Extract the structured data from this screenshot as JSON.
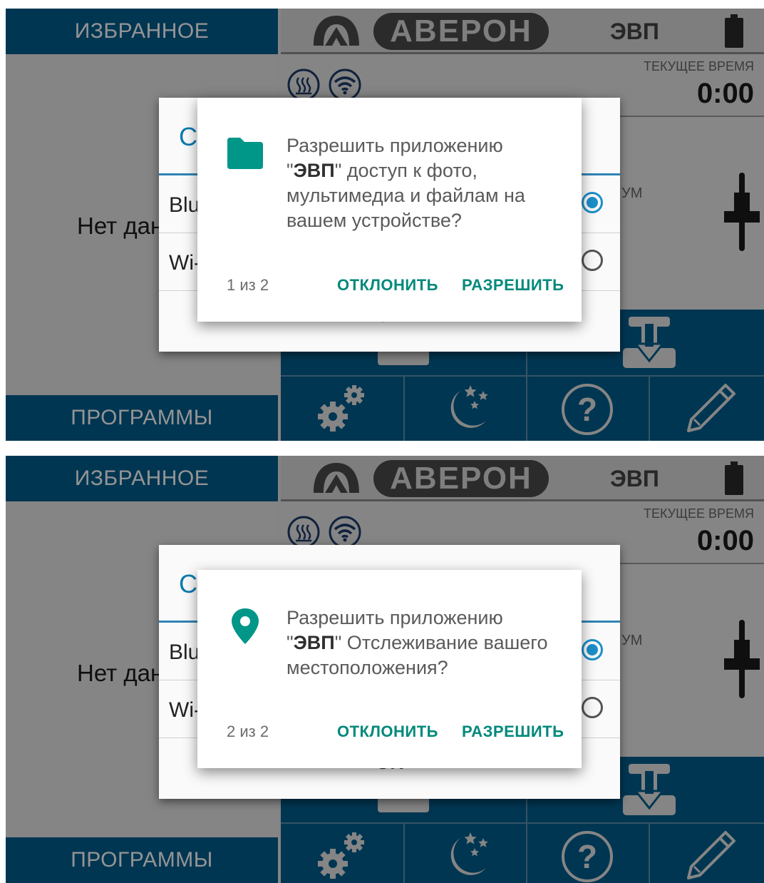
{
  "colors": {
    "brand_blue": "#005d8e",
    "dialog_accent": "#00897b",
    "connection_accent": "#1b8fc8"
  },
  "app": {
    "favorites_label": "ИЗБРАННОЕ",
    "programs_label": "ПРОГРАММЫ",
    "no_data_text": "Нет дан",
    "brand_text": "АВЕРОН",
    "app_name": "ЭВП",
    "current_time_label": "ТЕКУЩЕЕ ВРЕМЯ",
    "current_time": "0:00",
    "vu_label": "УМ",
    "icons": [
      "averon-logo-icon",
      "battery-icon",
      "heat-icon",
      "wifi-icon",
      "slider-icon",
      "upload-icon",
      "gears-icon",
      "night-icon",
      "help-icon",
      "edit-icon"
    ]
  },
  "connection_dialog": {
    "title": "Со",
    "options": [
      {
        "label": "Blue",
        "selected": true
      },
      {
        "label": "Wi-F",
        "selected": false
      }
    ],
    "ok_label": "OK"
  },
  "screens": [
    {
      "permission": {
        "icon": "folder-icon",
        "text_prefix": "Разрешить приложению\n\"",
        "app_name": "ЭВП",
        "text_suffix": "\" доступ к фото, мультимедиа и файлам на вашем устройстве?",
        "counter": "1 из 2",
        "deny_label": "ОТКЛОНИТЬ",
        "allow_label": "РАЗРЕШИТЬ"
      }
    },
    {
      "permission": {
        "icon": "location-pin-icon",
        "text_prefix": "Разрешить приложению\n\"",
        "app_name": "ЭВП",
        "text_suffix": "\" Отслеживание вашего местоположения?",
        "counter": "2 из 2",
        "deny_label": "ОТКЛОНИТЬ",
        "allow_label": "РАЗРЕШИТЬ"
      }
    }
  ]
}
